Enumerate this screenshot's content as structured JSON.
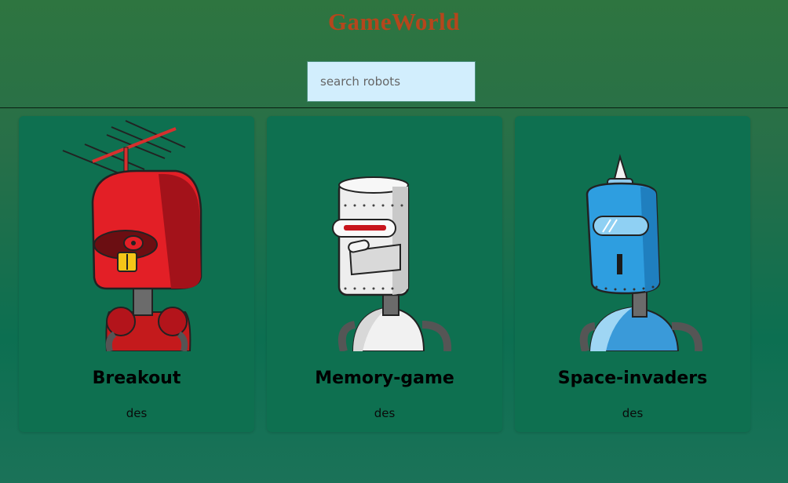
{
  "header": {
    "title": "GameWorld"
  },
  "search": {
    "placeholder": "search robots",
    "value": ""
  },
  "colors": {
    "title": "#b5461c",
    "search_bg": "#d2eefd",
    "card_bg": "#0e7050"
  },
  "cards": [
    {
      "name": "Breakout",
      "description": "des",
      "image": "red-robot-icon"
    },
    {
      "name": "Memory-game",
      "description": "des",
      "image": "white-robot-icon"
    },
    {
      "name": "Space-invaders",
      "description": "des",
      "image": "blue-robot-icon"
    }
  ]
}
